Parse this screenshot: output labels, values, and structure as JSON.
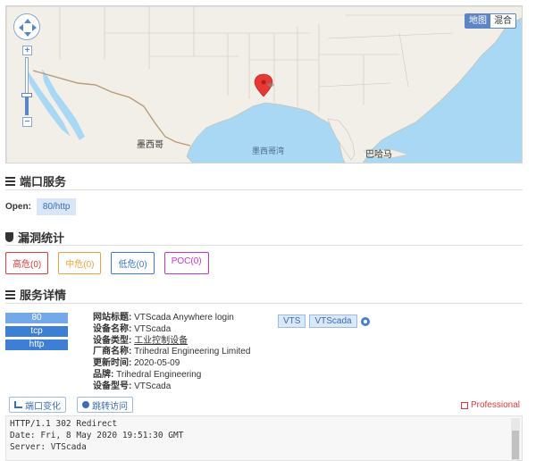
{
  "map": {
    "type_options": [
      "地图",
      "混合"
    ],
    "active_type": "地图",
    "labels": {
      "mexico": "墨西哥",
      "gulf": "墨西哥湾",
      "bahamas": "巴哈马"
    }
  },
  "sections": {
    "ports": {
      "title": "端口服务",
      "open_label": "Open:",
      "ports": [
        "80/http"
      ]
    },
    "vulns": {
      "title": "漏洞统计",
      "high": "高危(0)",
      "mid": "中危(0)",
      "low": "低危(0)",
      "poc": "POC(0)"
    },
    "service": {
      "title": "服务详情",
      "tags": [
        "80",
        "tcp",
        "http"
      ],
      "fields": [
        {
          "key": "网站标题:",
          "value": "VTScada Anywhere login"
        },
        {
          "key": "设备名称:",
          "value": "VTScada"
        },
        {
          "key": "设备类型:",
          "value": "工业控制设备"
        },
        {
          "key": "厂商名称:",
          "value": "Trihedral Engineering Limited"
        },
        {
          "key": "更新时间:",
          "value": "2020-05-09"
        },
        {
          "key": "品牌:",
          "value": "Trihedral Engineering"
        },
        {
          "key": "设备型号:",
          "value": "VTScada"
        }
      ],
      "product_tags": [
        "VTS",
        "VTScada"
      ]
    }
  },
  "toolbar": {
    "port_change": "端口变化",
    "jump_visit": "跳转访问",
    "professional": "Professional"
  },
  "banner": {
    "lines": [
      "HTTP/1.1 302 Redirect",
      "Date: Fri, 8 May 2020 19:51:30 GMT",
      "Server: VTScada"
    ]
  },
  "colors": {
    "accent": "#3b6cb5",
    "map_water": "#a9d8f5",
    "map_land": "#f2efe9",
    "marker": "#e53935",
    "high": "#e03a3a",
    "mid": "#f0a13c",
    "low": "#3b78d8",
    "poc": "#cc33cc"
  },
  "icons": {
    "marker": "map-pin-icon",
    "list": "list-icon",
    "shield": "shield-icon",
    "gear": "gear-icon",
    "bar": "bar-chart-icon",
    "globe": "globe-icon",
    "pro": "professional-icon"
  }
}
